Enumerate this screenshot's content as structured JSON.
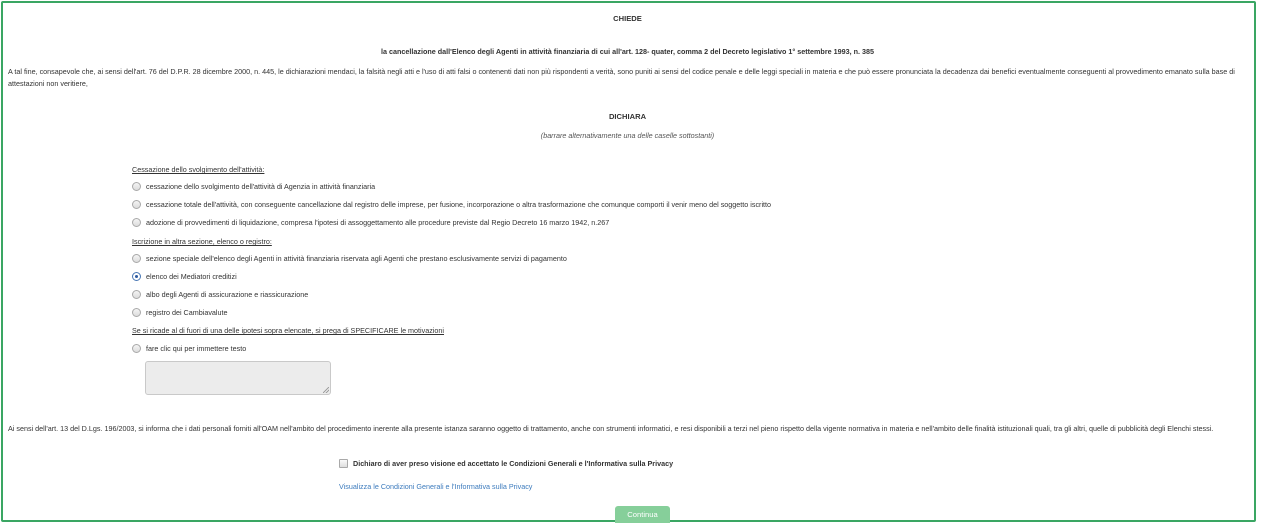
{
  "header": {
    "chiede": "CHIEDE",
    "request_line": "la cancellazione dall'Elenco degli Agenti in attività finanziaria di cui all'art. 128- quater, comma 2 del Decreto legislativo 1° settembre 1993, n. 385"
  },
  "intro_paragraph": "A tal fine, consapevole che, ai sensi dell'art. 76 del D.P.R. 28 dicembre 2000, n. 445, le dichiarazioni mendaci, la falsità negli atti e l'uso di atti falsi o contenenti dati non più rispondenti a verità, sono puniti ai sensi del codice penale e delle leggi speciali in materia e che può essere pronunciata la decadenza dai benefici eventualmente conseguenti al provvedimento emanato sulla base di attestazioni non veritiere,",
  "dichiara": {
    "title": "DICHIARA",
    "subtitle": "(barrare alternativamente una delle caselle sottostanti)"
  },
  "section1": {
    "title": "Cessazione dello svolgimento dell'attività:",
    "options": [
      {
        "label": "cessazione dello svolgimento dell'attività di Agenzia in attività finanziaria",
        "checked": false
      },
      {
        "label": "cessazione totale dell'attività, con conseguente cancellazione dal registro delle imprese, per fusione, incorporazione o altra trasformazione che comunque comporti il venir meno del soggetto iscritto",
        "checked": false
      },
      {
        "label": "adozione di provvedimenti di liquidazione, compresa l'ipotesi di assoggettamento alle procedure previste dal Regio Decreto 16 marzo 1942, n.267",
        "checked": false
      }
    ]
  },
  "section2": {
    "title": "Iscrizione in altra sezione, elenco o registro:",
    "options": [
      {
        "label": "sezione speciale dell'elenco degli Agenti in attività finanziaria riservata agli Agenti che prestano esclusivamente servizi di pagamento",
        "checked": false
      },
      {
        "label": "elenco dei Mediatori creditizi",
        "checked": true
      },
      {
        "label": "albo degli Agenti di assicurazione e riassicurazione",
        "checked": false
      },
      {
        "label": "registro dei Cambiavalute",
        "checked": false
      }
    ]
  },
  "section3": {
    "title": "Se si ricade al di fuori di una delle ipotesi sopra elencate, si prega di SPECIFICARE le motivazioni",
    "options": [
      {
        "label": "fare clic qui per immettere testo",
        "checked": false
      }
    ],
    "textarea_value": ""
  },
  "privacy_paragraph": "Ai sensi dell'art. 13 del D.Lgs. 196/2003, si informa che i dati personali forniti all'OAM nell'ambito del procedimento inerente alla presente istanza saranno oggetto di trattamento, anche con strumenti informatici, e resi disponibili a terzi nel pieno rispetto della vigente normativa in materia e nell'ambito delle finalità istituzionali quali, tra gli altri, quelle di pubblicità degli Elenchi stessi.",
  "consent": {
    "label": "Dichiaro di aver preso visione ed accettato le Condizioni Generali e l'Informativa sulla Privacy",
    "checked": false,
    "link_text": "Visualizza le Condizioni Generali e l'Informativa sulla Privacy"
  },
  "continue_button": "Continua",
  "colors": {
    "frame_border": "#3aa663",
    "button_bg": "#86cf9a",
    "link": "#3c7bbd"
  }
}
